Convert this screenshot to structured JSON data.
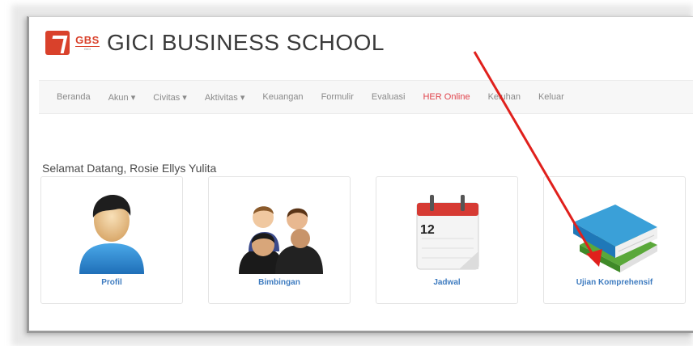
{
  "header": {
    "logo_text": "GBS",
    "logo_subtext": "GICI",
    "title": "GICI BUSINESS SCHOOL"
  },
  "nav": {
    "items": [
      {
        "label": "Beranda"
      },
      {
        "label": "Akun ▾"
      },
      {
        "label": "Civitas ▾"
      },
      {
        "label": "Aktivitas ▾"
      },
      {
        "label": "Keuangan"
      },
      {
        "label": "Formulir"
      },
      {
        "label": "Evaluasi"
      },
      {
        "label": "HER Online",
        "active": true
      },
      {
        "label": "Keluhan"
      },
      {
        "label": "Keluar"
      }
    ]
  },
  "main": {
    "welcome": "Selamat Datang, Rosie Ellys Yulita",
    "cards": [
      {
        "label": "Profil",
        "icon": "person-icon"
      },
      {
        "label": "Bimbingan",
        "icon": "people-group-icon"
      },
      {
        "label": "Jadwal",
        "icon": "calendar-icon"
      },
      {
        "label": "Ujian Komprehensif",
        "icon": "books-icon"
      }
    ],
    "calendar_day": "12"
  },
  "colors": {
    "accent": "#d9412b",
    "link": "#3f7cc0",
    "active_nav": "#e0434b",
    "annotation_arrow": "#e0201c"
  }
}
